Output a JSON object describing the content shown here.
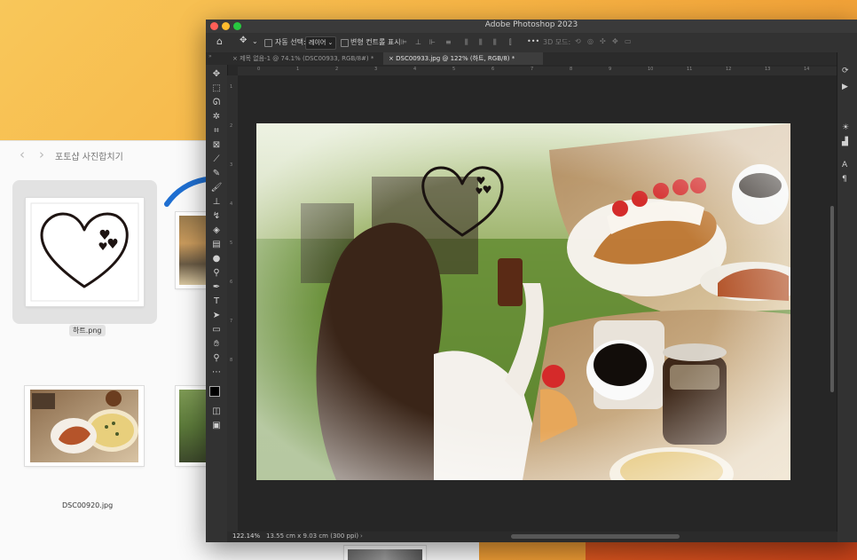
{
  "finder": {
    "title": "포토샵 사진합치기",
    "back_glyph": "‹",
    "forward_glyph": "›",
    "files": [
      {
        "name": "하트.png",
        "selected": true
      },
      {
        "name": "DSC00920.jpg",
        "selected": false
      }
    ]
  },
  "photoshop": {
    "title": "Adobe Photoshop 2023",
    "options": {
      "auto_select_label": "자동 선택:",
      "layer_dropdown": "레이어",
      "transform_controls_label": "변형 컨트롤 표시",
      "more": "•••",
      "mode_3d": "3D 모드:"
    },
    "tabs": [
      {
        "label": "제목 없음-1 @ 74.1% (DSC00933, RGB/8#) *",
        "active": false
      },
      {
        "label": "DSC00933.jpg @ 122% (하트, RGB/8) *",
        "active": true
      }
    ],
    "rulers": {
      "top": [
        "0",
        "1",
        "2",
        "3",
        "4",
        "5",
        "6",
        "7",
        "8",
        "9",
        "10",
        "11",
        "12",
        "13",
        "14"
      ],
      "left": [
        "1",
        "2",
        "3",
        "4",
        "5",
        "6",
        "7",
        "8"
      ]
    },
    "status": {
      "zoom": "122.14%",
      "doc_info": "13.55 cm x 9.03 cm (300 ppi)",
      "arrow": "›"
    }
  },
  "colors": {
    "accent_arrow": "#1f6fd1",
    "traffic_close": "#ff5f57",
    "traffic_min": "#febc2e",
    "traffic_max": "#28c840"
  }
}
